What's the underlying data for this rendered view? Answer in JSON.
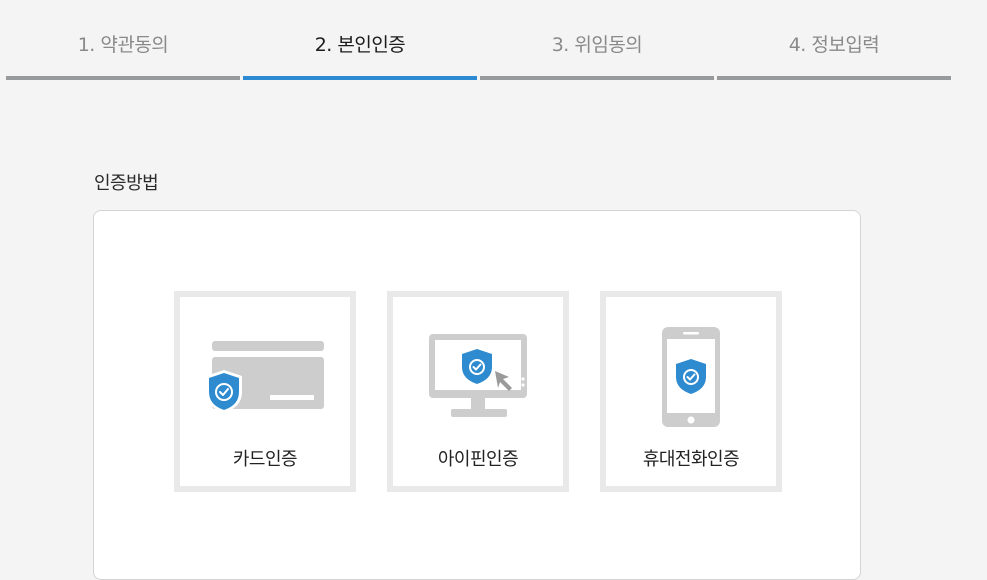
{
  "steps": [
    {
      "label": "1. 약관동의",
      "active": false
    },
    {
      "label": "2. 본인인증",
      "active": true
    },
    {
      "label": "3. 위임동의",
      "active": false
    },
    {
      "label": "4. 정보입력",
      "active": false
    }
  ],
  "section": {
    "title": "인증방법"
  },
  "methods": [
    {
      "label": "카드인증",
      "icon": "credit-card-shield-icon"
    },
    {
      "label": "아이핀인증",
      "icon": "monitor-shield-icon"
    },
    {
      "label": "휴대전화인증",
      "icon": "mobile-phone-shield-icon"
    }
  ],
  "colors": {
    "accent": "#2b8ad2",
    "inactive_bar": "#97999b",
    "icon_gray": "#cdcdcd",
    "shield_blue": "#2e8bd0"
  }
}
